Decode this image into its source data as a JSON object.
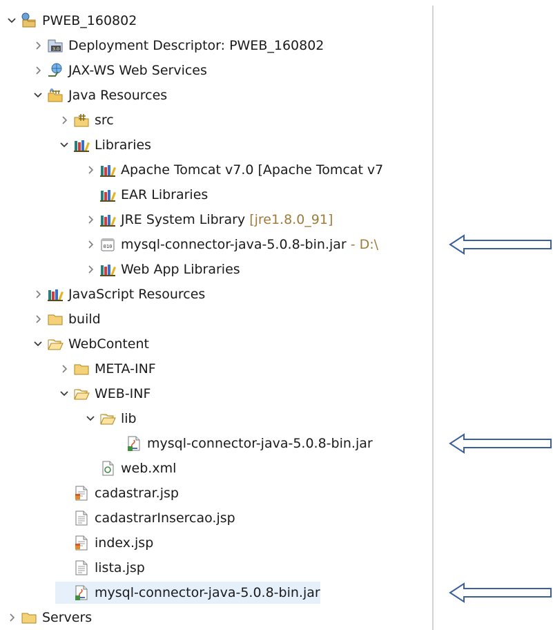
{
  "tree": [
    {
      "label": "PWEB_160802",
      "depth": 0,
      "twisty": "open",
      "icon": "web-project-icon"
    },
    {
      "label": "Deployment Descriptor: PWEB_160802",
      "depth": 1,
      "twisty": "closed",
      "icon": "deployment-descriptor-icon"
    },
    {
      "label": "JAX-WS Web Services",
      "depth": 1,
      "twisty": "closed",
      "icon": "web-services-icon"
    },
    {
      "label": "Java Resources",
      "depth": 1,
      "twisty": "open",
      "icon": "java-resources-icon"
    },
    {
      "label": "src",
      "depth": 2,
      "twisty": "closed",
      "icon": "source-folder-icon"
    },
    {
      "label": "Libraries",
      "depth": 2,
      "twisty": "open",
      "icon": "library-icon"
    },
    {
      "label": "Apache Tomcat v7.0 [Apache Tomcat v7",
      "depth": 3,
      "twisty": "closed",
      "icon": "library-icon"
    },
    {
      "label": "EAR Libraries",
      "depth": 3,
      "twisty": "none",
      "icon": "library-icon"
    },
    {
      "label": "JRE System Library",
      "decoration": "[jre1.8.0_91]",
      "depth": 3,
      "twisty": "closed",
      "icon": "library-icon"
    },
    {
      "label": "mysql-connector-java-5.0.8-bin.jar",
      "decoration": "- D:\\",
      "depth": 3,
      "twisty": "closed",
      "icon": "jar-icon"
    },
    {
      "label": "Web App Libraries",
      "depth": 3,
      "twisty": "closed",
      "icon": "library-icon"
    },
    {
      "label": "JavaScript Resources",
      "depth": 1,
      "twisty": "closed",
      "icon": "library-icon"
    },
    {
      "label": "build",
      "depth": 1,
      "twisty": "closed",
      "icon": "folder-icon"
    },
    {
      "label": "WebContent",
      "depth": 1,
      "twisty": "open",
      "icon": "folder-open-icon"
    },
    {
      "label": "META-INF",
      "depth": 2,
      "twisty": "closed",
      "icon": "folder-icon"
    },
    {
      "label": "WEB-INF",
      "depth": 2,
      "twisty": "open",
      "icon": "folder-open-icon"
    },
    {
      "label": "lib",
      "depth": 3,
      "twisty": "open",
      "icon": "folder-open-icon"
    },
    {
      "label": "mysql-connector-java-5.0.8-bin.jar",
      "depth": 4,
      "twisty": "none",
      "icon": "jar-file-icon"
    },
    {
      "label": "web.xml",
      "depth": 3,
      "twisty": "none",
      "icon": "xml-file-icon"
    },
    {
      "label": "cadastrar.jsp",
      "depth": 2,
      "twisty": "none",
      "icon": "jsp-file-icon"
    },
    {
      "label": "cadastrarInsercao.jsp",
      "depth": 2,
      "twisty": "none",
      "icon": "text-file-icon"
    },
    {
      "label": "index.jsp",
      "depth": 2,
      "twisty": "none",
      "icon": "jsp-file-icon"
    },
    {
      "label": "lista.jsp",
      "depth": 2,
      "twisty": "none",
      "icon": "text-file-icon"
    },
    {
      "label": "mysql-connector-java-5.0.8-bin.jar",
      "depth": 2,
      "twisty": "none",
      "icon": "jar-file-icon",
      "selected": true
    },
    {
      "label": "Servers",
      "depth": 0,
      "twisty": "closed",
      "icon": "folder-icon"
    }
  ],
  "annotation_arrow_rows": [
    9,
    17,
    23
  ],
  "colors": {
    "arrow": "#3b5f9a",
    "selection": "#e6f0fb",
    "decoration": "#a07a3a",
    "text": "#1a1a1a"
  }
}
